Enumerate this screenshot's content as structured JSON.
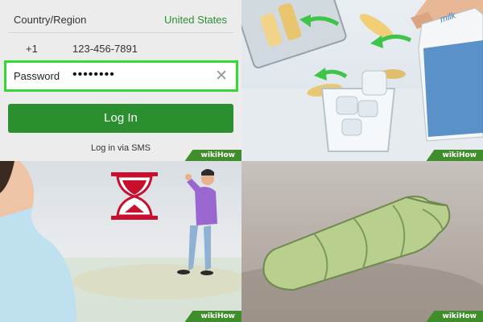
{
  "login": {
    "country_label": "Country/Region",
    "country_value": "United States",
    "country_code": "+1",
    "phone_number": "123-456-7891",
    "password_label": "Password",
    "password_value": "••••••••",
    "login_button": "Log In",
    "sms_link": "Log in via SMS"
  },
  "watermark": "wikiHow",
  "colors": {
    "accent_green": "#2b8e2f",
    "highlight_green": "#34d934",
    "watermark_green": "#3f8d2b"
  },
  "icons": [
    "clear-icon",
    "hourglass-icon"
  ]
}
